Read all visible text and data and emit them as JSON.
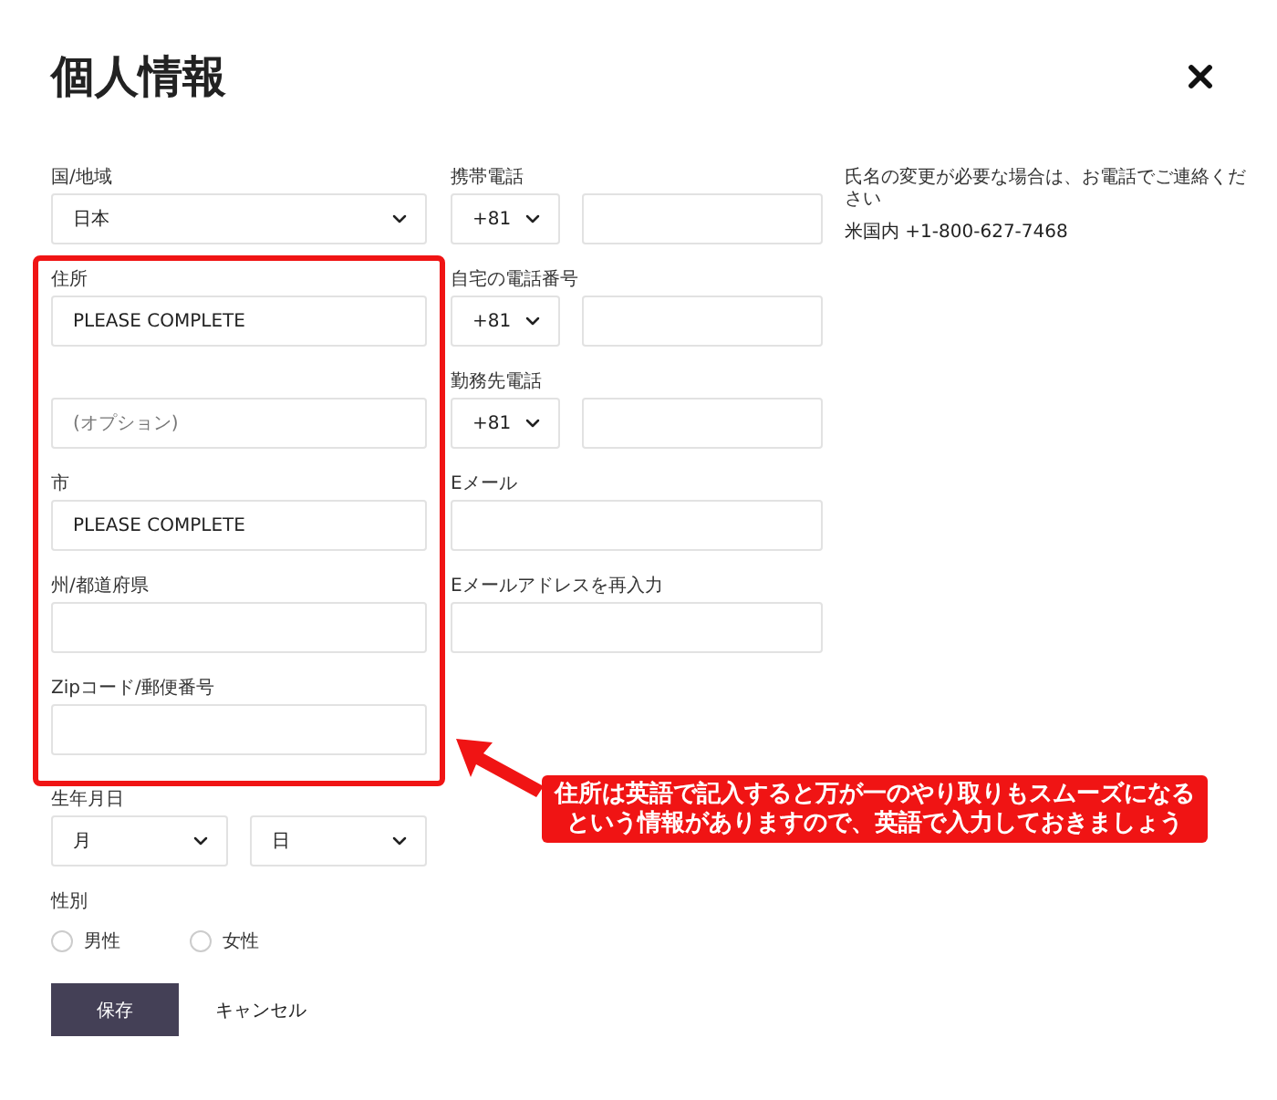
{
  "title": "個人情報",
  "country": {
    "label": "国/地域",
    "value": "日本"
  },
  "address_fields": [
    {
      "label": "住所",
      "value": "PLEASE COMPLETE"
    },
    {
      "placeholder": "(オプション)"
    },
    {
      "label": "市",
      "value": "PLEASE COMPLETE"
    },
    {
      "label": "州/都道府県"
    },
    {
      "label": "Zipコード/郵便番号"
    }
  ],
  "birthdate": {
    "label": "生年月日",
    "selects": [
      {
        "value": "月"
      },
      {
        "value": "日"
      }
    ]
  },
  "gender": {
    "label": "性別",
    "options": [
      {
        "label": "男性",
        "selected": false
      },
      {
        "label": "女性",
        "selected": false
      }
    ]
  },
  "buttons": {
    "save": "保存",
    "cancel": "キャンセル"
  },
  "phones": [
    {
      "label": "携帯電話",
      "code": "+81"
    },
    {
      "label": "自宅の電話番号",
      "code": "+81"
    },
    {
      "label": "勤務先電話",
      "code": "+81"
    }
  ],
  "emails": [
    {
      "label": "Eメール"
    },
    {
      "label": "Eメールアドレスを再入力"
    }
  ],
  "name_note": {
    "text": "氏名の変更が必要な場合は、お電話でご連絡ください",
    "phone": "米国内 +1-800-627-7468"
  },
  "annotation": {
    "lines": [
      "住所は英語で記入すると万が一のやり取りもスムーズになる",
      "という情報がありますので、英語で入力しておきましょう"
    ]
  }
}
